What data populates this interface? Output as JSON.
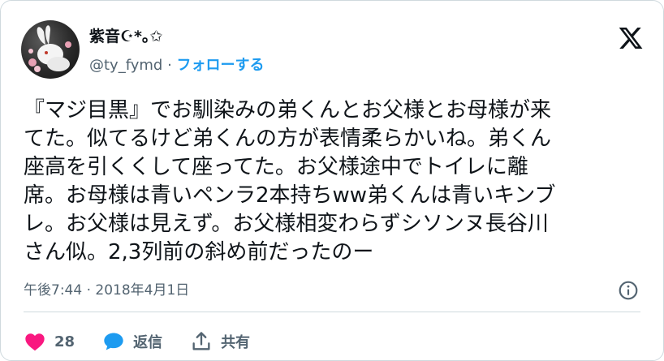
{
  "author": {
    "display_name": "紫音☪︎*｡✩",
    "handle": "@ty_fymd",
    "separator": "·",
    "follow_label": "フォローする"
  },
  "tweet": {
    "text": "『マジ目黒』でお馴染みの弟くんとお父様とお母様が来\nてた。似てるけど弟くんの方が表情柔らかいね。弟くん\n座高を引くくして座ってた。お父様途中でトイレに離\n席。お母様は青いペンラ2本持ちww弟くんは青いキンブ\nレ。お父様は見えず。お父様相変わらずシソンヌ長谷川\nさん似。2,3列前の斜め前だったのー",
    "timestamp": "午後7:44 · 2018年4月1日"
  },
  "actions": {
    "like_count": "28",
    "reply_label": "返信",
    "share_label": "共有"
  },
  "icons": {
    "logo": "x-logo-icon",
    "info": "info-icon",
    "like": "heart-icon",
    "reply": "speech-bubble-icon",
    "share": "share-upload-icon"
  },
  "colors": {
    "like": "#f91880",
    "reply": "#1d9bf0",
    "follow": "#1d9bf0",
    "muted": "#536471",
    "text": "#0f1419"
  }
}
